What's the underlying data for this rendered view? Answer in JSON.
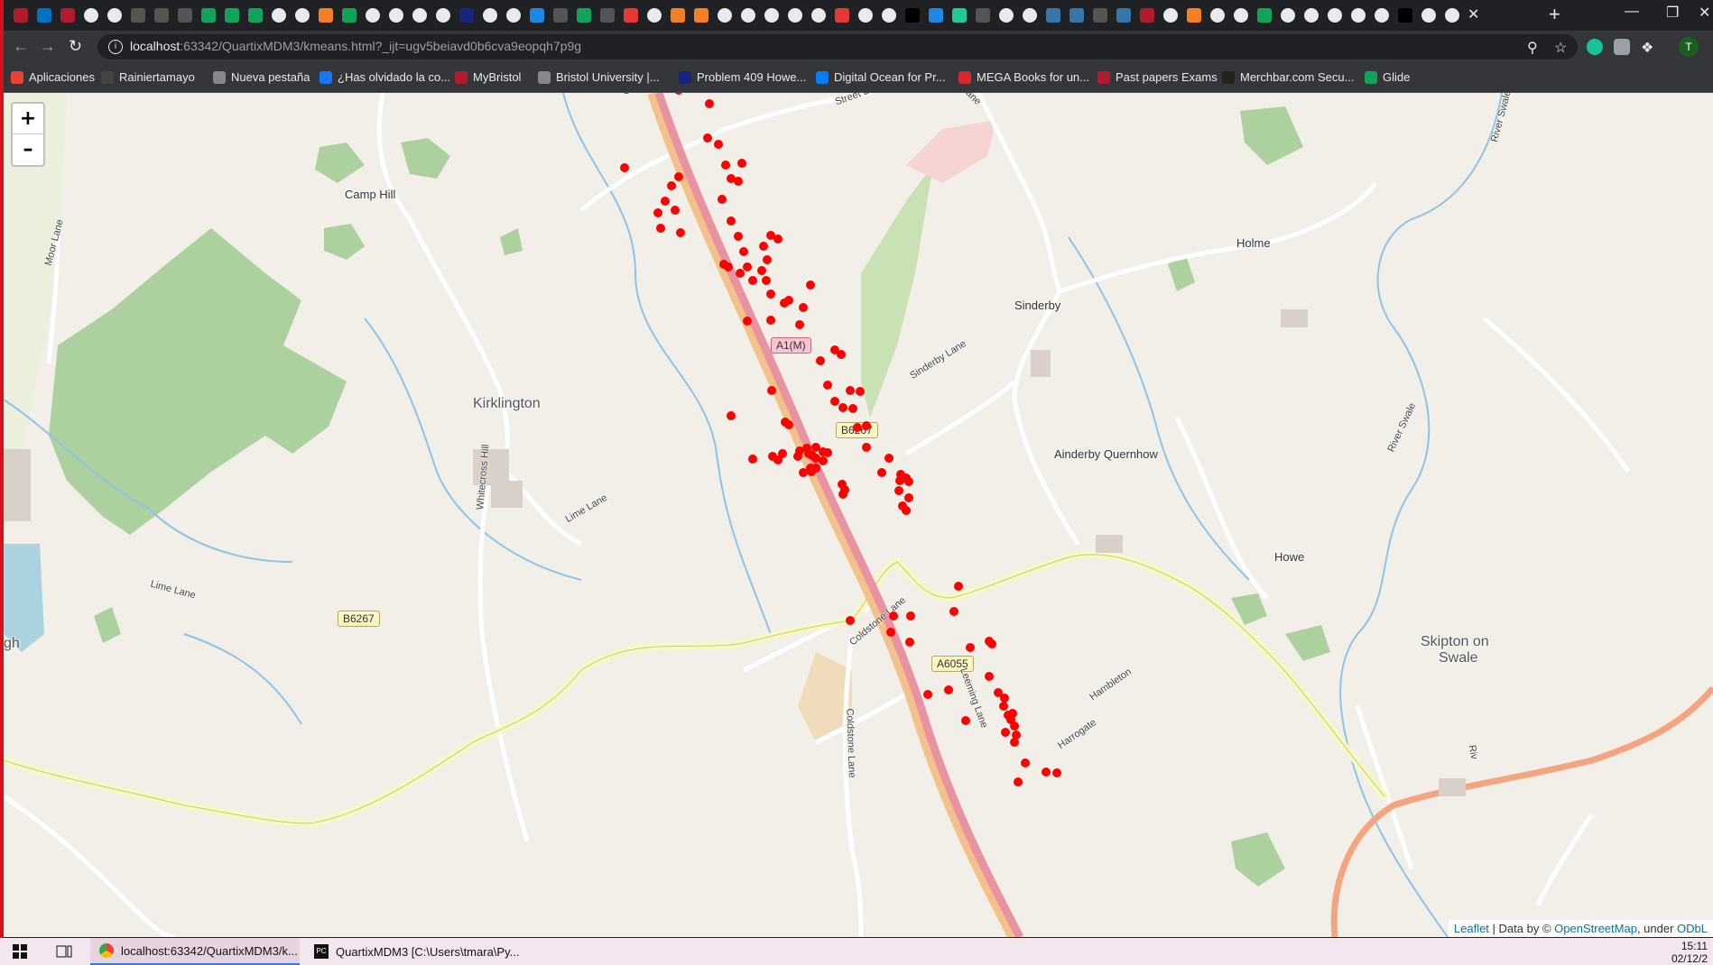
{
  "browser": {
    "url_host": "localhost",
    "url_rest": ":63342/QuartixMDM3/kmeans.html?_ijt=ugv5beiavd0b6cva9eopqh7p9g",
    "bookmarks": [
      {
        "label": "Aplicaciones",
        "color": "#ea4335"
      },
      {
        "label": "Rainiertamayo",
        "color": "#444"
      },
      {
        "label": "Nueva pestaña",
        "color": "#888"
      },
      {
        "label": "¿Has olvidado la co...",
        "color": "#1877f2"
      },
      {
        "label": "MyBristol",
        "color": "#b01c2e"
      },
      {
        "label": "Bristol University |...",
        "color": "#888"
      },
      {
        "label": "Problem 409 Howe...",
        "color": "#1a237e"
      },
      {
        "label": "Digital Ocean for Pr...",
        "color": "#0080ff"
      },
      {
        "label": "MEGA Books for un...",
        "color": "#d9272e"
      },
      {
        "label": "Past papers Exams",
        "color": "#b01c2e"
      },
      {
        "label": "Merchbar.com Secu...",
        "color": "#222"
      },
      {
        "label": "Glide",
        "color": "#12a35b"
      }
    ],
    "profile_initial": "T"
  },
  "map": {
    "zoom_in": "+",
    "zoom_out": "–",
    "attribution": {
      "leaflet": "Leaflet",
      "data_by": " | Data by © ",
      "osm": "OpenStreetMap",
      "under": ", under ",
      "odbl": "ODbL"
    },
    "places": {
      "camp_hill": "Camp Hill",
      "kirklington": "Kirklington",
      "sinderby": "Sinderby",
      "holme": "Holme",
      "ainderby_quernhow": "Ainderby Quernhow",
      "howe": "Howe",
      "skipton": "Skipton on",
      "swale": "Swale",
      "gh": "gh"
    },
    "roads": {
      "a1m": "A1(M)",
      "b6267a": "B6267",
      "b6267b": "B6267",
      "a6055": "A6055",
      "street_lane": "Street Lane",
      "ss_lane": "ss Lane",
      "moor_lane": "Moor Lane",
      "sinderby_lane": "Sinderby Lane",
      "whitecross_hill": "Whitecross Hill",
      "lime_lane_a": "Lime Lane",
      "lime_lane_b": "Lime Lane",
      "coldstone_lane_a": "Coldstone Lane",
      "coldstone_lane_b": "Coldstone Lane",
      "leeming_lane": "Leeming Lane",
      "river_swale_a": "River Swale",
      "river_swale_b": "River Swale",
      "hambleton": "Hambleton",
      "harrogate": "Harrogate",
      "riv": "Riv"
    },
    "marker_color": "#ff0000"
  },
  "taskbar": {
    "items": [
      {
        "label": "localhost:63342/QuartixMDM3/k..."
      },
      {
        "label": "QuartixMDM3 [C:\\Users\\tmara\\Py..."
      }
    ],
    "time": "15:11",
    "date": "02/12/2"
  }
}
